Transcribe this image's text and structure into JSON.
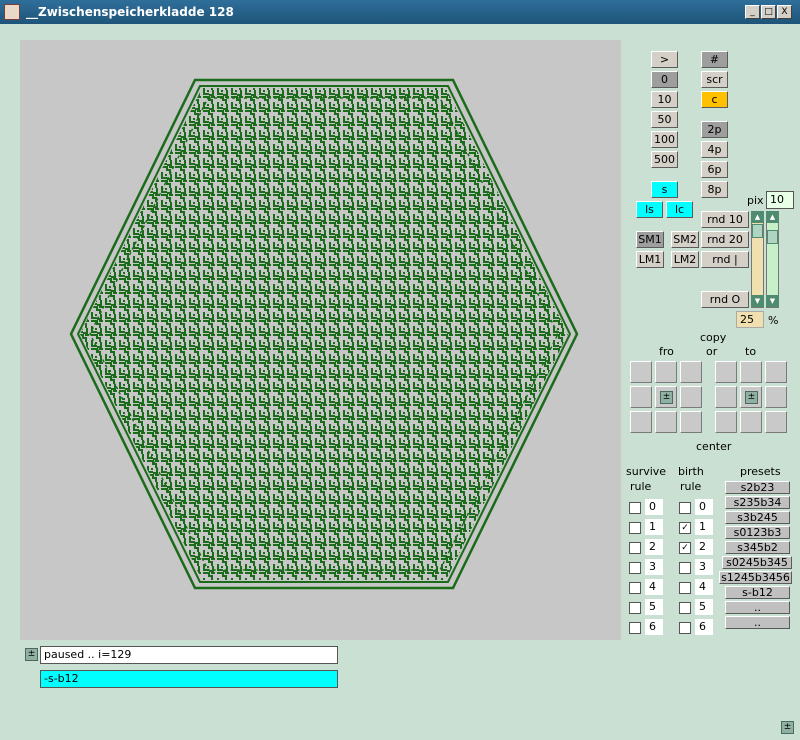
{
  "window": {
    "title": "__Zwischenspeicherkladde 128",
    "buttons": [
      "_",
      "□",
      "X"
    ]
  },
  "speed_buttons": [
    ">",
    "0",
    "10",
    "50",
    "100",
    "500"
  ],
  "view_buttons": [
    "#",
    "scr",
    "c"
  ],
  "pass_buttons": [
    "2p",
    "4p",
    "6p",
    "8p"
  ],
  "s_button": "s",
  "ls_button": "ls",
  "lc_button": "lc",
  "memory_buttons": [
    "SM1",
    "SM2",
    "LM1",
    "LM2"
  ],
  "rnd_buttons": [
    "rnd 10",
    "rnd 20",
    "rnd |",
    "rnd O"
  ],
  "pix": {
    "label": "pix",
    "value": "10"
  },
  "percent": {
    "value": "25",
    "unit": "%"
  },
  "copy": {
    "copy_label": "copy",
    "or_label": "or",
    "fro_label": "fro",
    "to_label": "to",
    "center_label": "center",
    "center_symbol": "±"
  },
  "survive": {
    "title1": "survive",
    "title2": "rule",
    "items": [
      {
        "value": "0",
        "checked": false
      },
      {
        "value": "1",
        "checked": false
      },
      {
        "value": "2",
        "checked": false
      },
      {
        "value": "3",
        "checked": false
      },
      {
        "value": "4",
        "checked": false
      },
      {
        "value": "5",
        "checked": false
      },
      {
        "value": "6",
        "checked": false
      }
    ]
  },
  "birth": {
    "title1": "birth",
    "title2": "rule",
    "items": [
      {
        "value": "0",
        "checked": false
      },
      {
        "value": "1",
        "checked": true
      },
      {
        "value": "2",
        "checked": true
      },
      {
        "value": "3",
        "checked": false
      },
      {
        "value": "4",
        "checked": false
      },
      {
        "value": "5",
        "checked": false
      },
      {
        "value": "6",
        "checked": false
      }
    ]
  },
  "presets": {
    "title": "presets",
    "items": [
      "s2b23",
      "s235b34",
      "s3b245",
      "s0123b3",
      "s345b2",
      "s0245b345",
      "s1245b3456",
      "s-b12",
      "..",
      ".."
    ]
  },
  "status": {
    "toggle": "±",
    "text": "paused .. i=129"
  },
  "rule_field": "-s-b12",
  "corner_toggle": "±",
  "colors": {
    "background": "#c9e0d3",
    "cells": "#1a6b1a",
    "canvas": "#c7c7c7",
    "accent_cyan": "#00ffff",
    "accent_orange": "#ffc000"
  }
}
